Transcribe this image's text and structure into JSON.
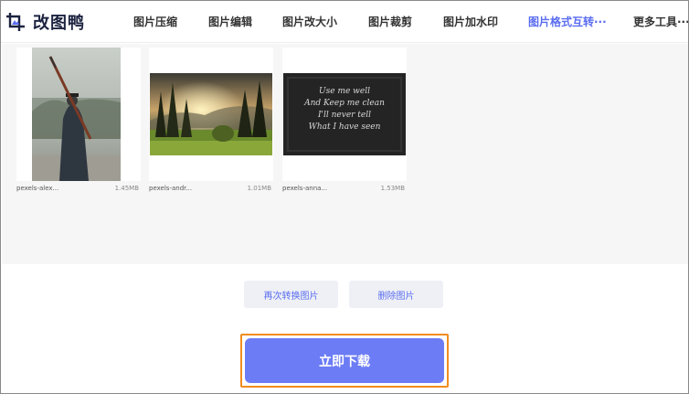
{
  "brand": {
    "name": "改图鸭",
    "icon": "crop-logo-icon",
    "color": "#1c2340"
  },
  "nav": {
    "items": [
      {
        "label": "图片压缩",
        "active": false
      },
      {
        "label": "图片编辑",
        "active": false
      },
      {
        "label": "图片改大小",
        "active": false
      },
      {
        "label": "图片裁剪",
        "active": false
      },
      {
        "label": "图片加水印",
        "active": false
      },
      {
        "label": "图片格式互转···",
        "active": true
      },
      {
        "label": "更多工具···",
        "active": false
      }
    ],
    "active_color": "#5a6cf0"
  },
  "files": [
    {
      "name": "pexels-alex...",
      "size": "1.45MB",
      "thumb": "man-with-rifle-photo"
    },
    {
      "name": "pexels-andr...",
      "size": "1.01MB",
      "thumb": "forest-sunset-photo"
    },
    {
      "name": "pexels-anna...",
      "size": "1.53MB",
      "thumb": "chalkboard-quote-photo",
      "chalk_text": [
        "Use me well",
        "And Keep me clean",
        "I'll never tell",
        "What I have seen"
      ]
    }
  ],
  "actions": {
    "convert_again": "再次转换图片",
    "delete": "删除图片",
    "download": "立即下载"
  },
  "colors": {
    "accent": "#6c7cf5",
    "highlight_border": "#f08c1e"
  }
}
